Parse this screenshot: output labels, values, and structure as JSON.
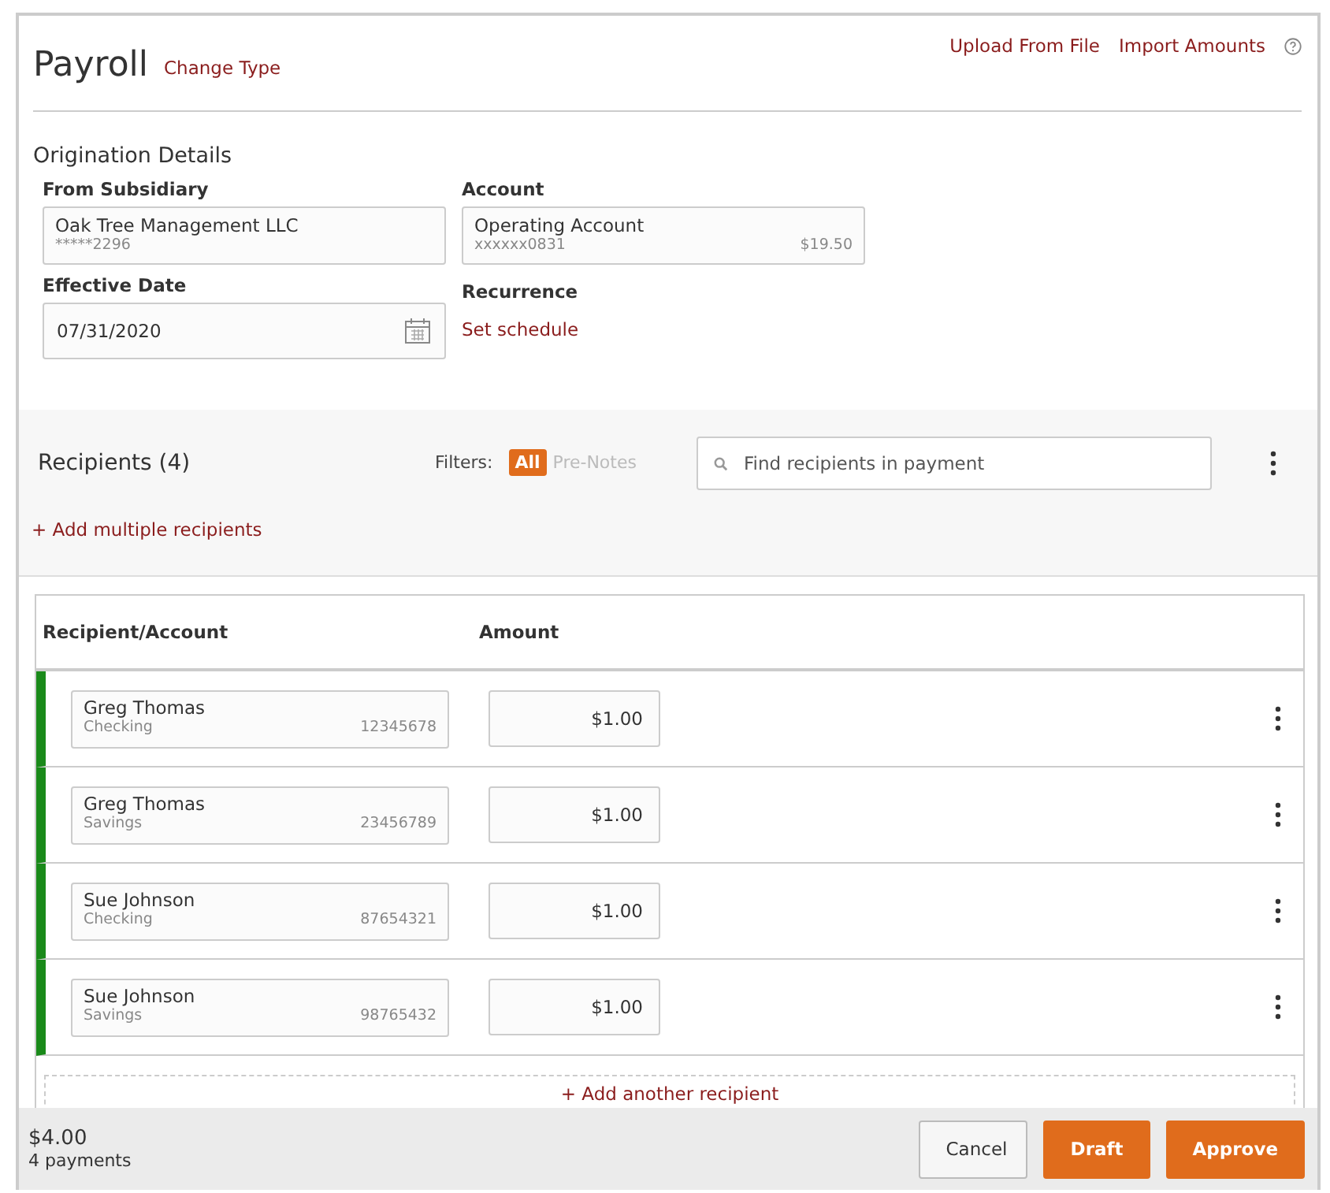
{
  "header": {
    "title": "Payroll",
    "change_type": "Change Type",
    "actions": [
      "Upload From File",
      "Import Amounts"
    ]
  },
  "origination": {
    "title": "Origination Details",
    "subsidiary": {
      "label": "From Subsidiary",
      "value": "Oak Tree Management LLC",
      "sub": "*****2296"
    },
    "account": {
      "label": "Account",
      "value": "Operating Account",
      "sub": "xxxxxx0831",
      "balance": "$19.50"
    },
    "effective_date": {
      "label": "Effective Date",
      "value": "07/31/2020"
    },
    "recurrence": {
      "label": "Recurrence",
      "link": "Set schedule"
    }
  },
  "recipients": {
    "title": "Recipients (4)",
    "filters_label": "Filters:",
    "filters": [
      {
        "label": "All",
        "selected": true
      },
      {
        "label": "Pre-Notes",
        "selected": false
      }
    ],
    "search": {
      "placeholder": "Find recipients in payment"
    },
    "add_multiple": "+ Add multiple recipients"
  },
  "table": {
    "columns": [
      "Recipient/Account",
      "Amount"
    ],
    "rows": [
      {
        "name": "Greg Thomas",
        "type": "Checking",
        "account": "12345678",
        "amount": "$1.00"
      },
      {
        "name": "Greg Thomas",
        "type": "Savings",
        "account": "23456789",
        "amount": "$1.00"
      },
      {
        "name": "Sue Johnson",
        "type": "Checking",
        "account": "87654321",
        "amount": "$1.00"
      },
      {
        "name": "Sue Johnson",
        "type": "Savings",
        "account": "98765432",
        "amount": "$1.00"
      }
    ],
    "add_another": "+ Add another recipient"
  },
  "footer": {
    "total": "$4.00",
    "count": "4 payments",
    "buttons": [
      {
        "label": "Cancel",
        "kind": "secondary"
      },
      {
        "label": "Draft",
        "kind": "primary"
      },
      {
        "label": "Approve",
        "kind": "primary"
      }
    ]
  }
}
